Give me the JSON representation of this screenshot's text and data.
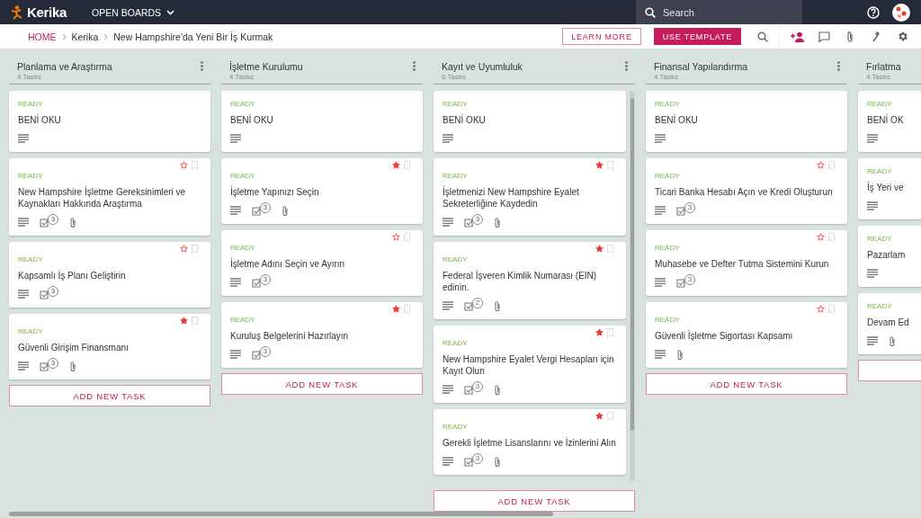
{
  "topbar": {
    "logo": "Kerika",
    "menu": "OPEN BOARDS",
    "search": {
      "placeholder": "Search"
    }
  },
  "breadcrumb": {
    "home": "HOME",
    "path": [
      "Kerika",
      "New Hampshire'da Yeni Bir İş Kurmak"
    ]
  },
  "actions": {
    "learn_more": "LEARN MORE",
    "use_template": "USE TEMPLATE"
  },
  "columns": [
    {
      "title": "Planlama ve Araştırma",
      "count": "4 Tasks",
      "add_task": "ADD NEW TASK",
      "scrollbar": false,
      "cards": [
        {
          "status": "READY",
          "title": "BENİ OKU",
          "attachment": false
        },
        {
          "status": "READY",
          "title": "New Hampshire İşletme Gereksinimleri ve Kaynakları Hakkında Araştırma",
          "starred": false,
          "checklist": "3",
          "attachment": true
        },
        {
          "status": "READY",
          "title": "Kapsamlı İş Planı Geliştirin",
          "starred": false,
          "checklist": "3",
          "attachment": false
        },
        {
          "status": "READY",
          "title": "Güvenli Girişim Finansmanı",
          "starred": true,
          "checklist": "3",
          "attachment": true
        }
      ]
    },
    {
      "title": "İşletme Kurulumu",
      "count": "4 Tasks",
      "add_task": "ADD NEW TASK",
      "scrollbar": false,
      "cards": [
        {
          "status": "READY",
          "title": "BENİ OKU",
          "attachment": false
        },
        {
          "status": "READY",
          "title": "İşletme Yapınızı Seçin",
          "starred": true,
          "checklist": "3",
          "attachment": true
        },
        {
          "status": "READY",
          "title": "İşletme Adını Seçin ve Ayırın",
          "starred": false,
          "checklist": "3",
          "attachment": false
        },
        {
          "status": "READY",
          "title": "Kuruluş Belgelerini Hazırlayın",
          "starred": true,
          "checklist": "3",
          "attachment": false
        }
      ]
    },
    {
      "title": "Kayıt ve Uyumluluk",
      "count": "6 Tasks",
      "add_task": "ADD NEW TASK",
      "scrollbar": true,
      "cards": [
        {
          "status": "READY",
          "title": "BENİ OKU",
          "attachment": false
        },
        {
          "status": "READY",
          "title": "İşletmenizi New Hampshire Eyalet Sekreterliğine Kaydedin",
          "starred": true,
          "checklist": "3",
          "attachment": true
        },
        {
          "status": "READY",
          "title": "Federal İşveren Kimlik Numarası (EIN) edinin.",
          "starred": true,
          "checklist": "2",
          "attachment": true
        },
        {
          "status": "READY",
          "title": "New Hampshire Eyalet Vergi Hesapları için Kayıt Olun",
          "starred": true,
          "checklist": "3",
          "attachment": true
        },
        {
          "status": "READY",
          "title": "Gerekli İşletme Lisanslarını ve İzinlerini Alın",
          "starred": true,
          "checklist": "3",
          "attachment": true
        }
      ]
    },
    {
      "title": "Finansal Yapılandırma",
      "count": "4 Tasks",
      "add_task": "ADD NEW TASK",
      "scrollbar": false,
      "cards": [
        {
          "status": "READY",
          "title": "BENİ OKU",
          "attachment": false
        },
        {
          "status": "READY",
          "title": "Ticari Banka Hesabı Açın ve Kredi Oluşturun",
          "starred": false,
          "checklist": "3",
          "attachment": false
        },
        {
          "status": "READY",
          "title": "Muhasebe ve Defter Tutma Sistemini Kurun",
          "starred": false,
          "checklist": "3",
          "attachment": false
        },
        {
          "status": "READY",
          "title": "Güvenli İşletme Sigortası Kapsamı",
          "starred": false,
          "attachment": true
        }
      ]
    },
    {
      "title": "Fırlatma",
      "count": "4 Tasks",
      "scrollbar": false,
      "cards": [
        {
          "status": "READY",
          "title": "BENİ OK",
          "attachment": false
        },
        {
          "status": "READY",
          "title": "İş Yeri ve",
          "attachment": false
        },
        {
          "status": "READY",
          "title": "Pazarlam",
          "attachment": false
        },
        {
          "status": "READY",
          "title": "Devam Ed",
          "attachment": true
        }
      ]
    }
  ]
}
